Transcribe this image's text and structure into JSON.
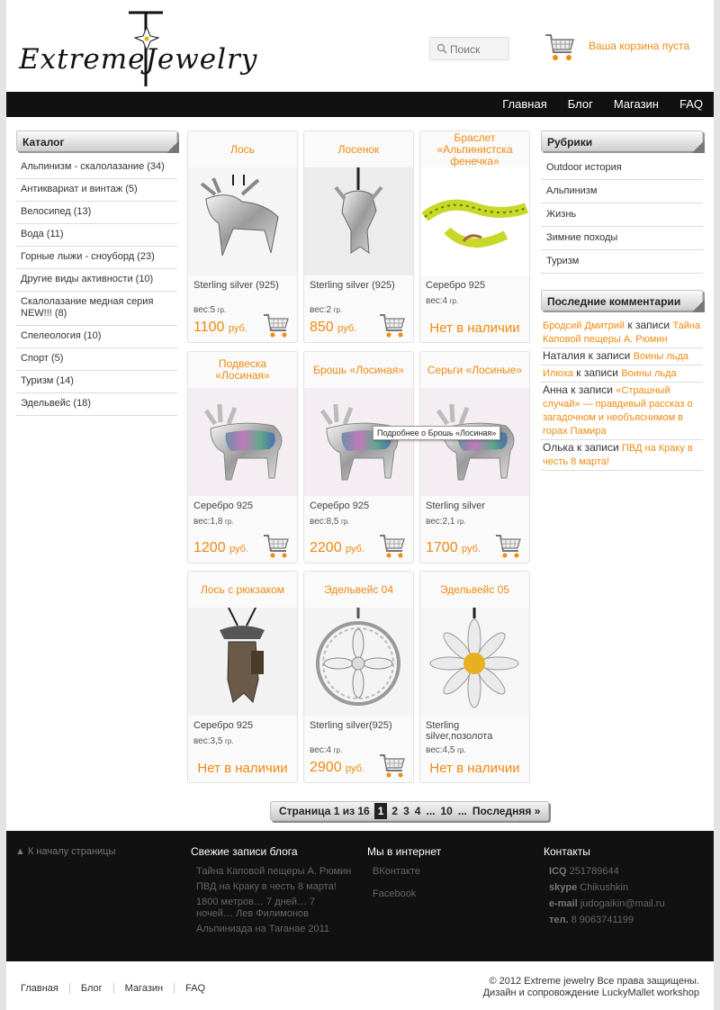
{
  "header": {
    "logo_text": "ExtremeJewelry",
    "search_placeholder": "Поиск",
    "cart_text": "Ваша корзина пуста"
  },
  "nav": [
    "Главная",
    "Блог",
    "Магазин",
    "FAQ"
  ],
  "catalog": {
    "title": "Каталог",
    "items": [
      "Альпинизм - скалолазание (34)",
      "Антиквариат и винтаж (5)",
      "Велосипед (13)",
      "Вода (11)",
      "Горные лыжи - сноуборд (23)",
      "Другие виды активности (10)",
      "Скалолазание медная серия NEW!!! (8)",
      "Спелеология (10)",
      "Спорт (5)",
      "Туризм (14)",
      "Эдельвейс (18)"
    ]
  },
  "rubrics": {
    "title": "Рубрики",
    "items": [
      "Outdoor история",
      "Альпинизм",
      "Жизнь",
      "Зимние походы",
      "Туризм"
    ]
  },
  "comments": {
    "title": "Последние комментарии",
    "items": [
      {
        "author": "Бродсий Дмитрий",
        "sep": "к записи",
        "post": "Тайна Каповой пещеры А. Рюмин"
      },
      {
        "author": "Наталия",
        "sep": "к записи",
        "post": "Воины льда"
      },
      {
        "author": "Илюха",
        "sep": "к записи",
        "post": "Воины льда"
      },
      {
        "author": "Анна",
        "sep": "к записи",
        "post": "«Страшный случай» — правдивый рассказ о загадочном и необъяснимом в горах Памира"
      },
      {
        "author": "Олька",
        "sep": "к записи",
        "post": "ПВД на Краку в честь 8 марта!"
      }
    ]
  },
  "products": [
    {
      "title": "Лось",
      "material": "Sterling silver (925)",
      "weight_label": "вес:",
      "weight": "5",
      "unit": "гр.",
      "price": "1100",
      "currency": "руб.",
      "available": true,
      "img": "moose"
    },
    {
      "title": "Лосенок",
      "material": "Sterling silver (925)",
      "weight_label": "вес:",
      "weight": "2",
      "unit": "гр.",
      "price": "850",
      "currency": "руб.",
      "available": true,
      "img": "calf"
    },
    {
      "title": "Браслет «Альпинистска фенечка»",
      "material": "Серебро 925",
      "weight_label": "вес:",
      "weight": "4",
      "unit": "гр.",
      "price": "",
      "currency": "",
      "available": false,
      "na_text": "Нет в наличии",
      "img": "bracelet"
    },
    {
      "title": "Подвеска «Лосиная»",
      "material": "Серебро 925",
      "weight_label": "вес:",
      "weight": "1,8",
      "unit": "гр.",
      "price": "1200",
      "currency": "руб.",
      "available": true,
      "img": "moose-shell"
    },
    {
      "title": "Брошь «Лосиная»",
      "material": "Серебро 925",
      "weight_label": "вес:",
      "weight": "8,5",
      "unit": "гр.",
      "price": "2200",
      "currency": "руб.",
      "available": true,
      "img": "moose-shell"
    },
    {
      "title": "Серьги «Лосиные»",
      "material": "Sterling silver",
      "weight_label": "вес:",
      "weight": "2,1",
      "unit": "гр.",
      "price": "1700",
      "currency": "руб.",
      "available": true,
      "img": "moose-shell"
    },
    {
      "title": "Лось с рюкзаком",
      "material": "Серебро 925",
      "weight_label": "вес:",
      "weight": "3,5",
      "unit": "гр.",
      "price": "",
      "currency": "",
      "available": false,
      "na_text": "Нет в наличии",
      "img": "backpack"
    },
    {
      "title": "Эдельвейс 04",
      "material": "Sterling silver(925)",
      "weight_label": "вес:",
      "weight": "4",
      "unit": "гр.",
      "price": "2900",
      "currency": "руб.",
      "available": true,
      "img": "edelweiss-ring"
    },
    {
      "title": "Эдельвейс 05",
      "material": "Sterling silver,позолота",
      "weight_label": "вес:",
      "weight": "4,5",
      "unit": "гр.",
      "price": "",
      "currency": "",
      "available": false,
      "na_text": "Нет в наличии",
      "img": "edelweiss-gold"
    }
  ],
  "tooltip": "Подробнее о Брошь «Лосиная»",
  "pager": {
    "label": "Страница 1 из 16",
    "current": "1",
    "pages": [
      "2",
      "3",
      "4",
      "...",
      "10",
      "..."
    ],
    "last": "Последняя »"
  },
  "footer": {
    "to_top": "▲ К началу страницы",
    "blog_title": "Свежие записи блога",
    "blog_items": [
      "Тайна Каповой пещеры А. Рюмин",
      "ПВД на Краку в честь 8 марта!",
      "1800 метров… 7 дней… 7 ночей… Лев Филимонов",
      "Альпиниада на Таганае 2011"
    ],
    "web_title": "Мы в интернет",
    "web_items": [
      "ВКонтакте",
      "Facebook"
    ],
    "contacts_title": "Контакты",
    "contacts": [
      {
        "label": "ICQ",
        "value": "251789644"
      },
      {
        "label": "skype",
        "value": "Chikushkin"
      },
      {
        "label": "e-mail",
        "value": "judogaikin@mail.ru"
      },
      {
        "label": "тел.",
        "value": "8 9063741199"
      }
    ]
  },
  "bottom": {
    "nav": [
      "Главная",
      "Блог",
      "Магазин",
      "FAQ"
    ],
    "copyright": "© 2012 Extreme jewelry Все права защищены.",
    "credits": "Дизайн и сопровождение LuckyMallet workshop"
  },
  "colors": {
    "accent": "#f08a10",
    "nav_bg": "#111111"
  }
}
